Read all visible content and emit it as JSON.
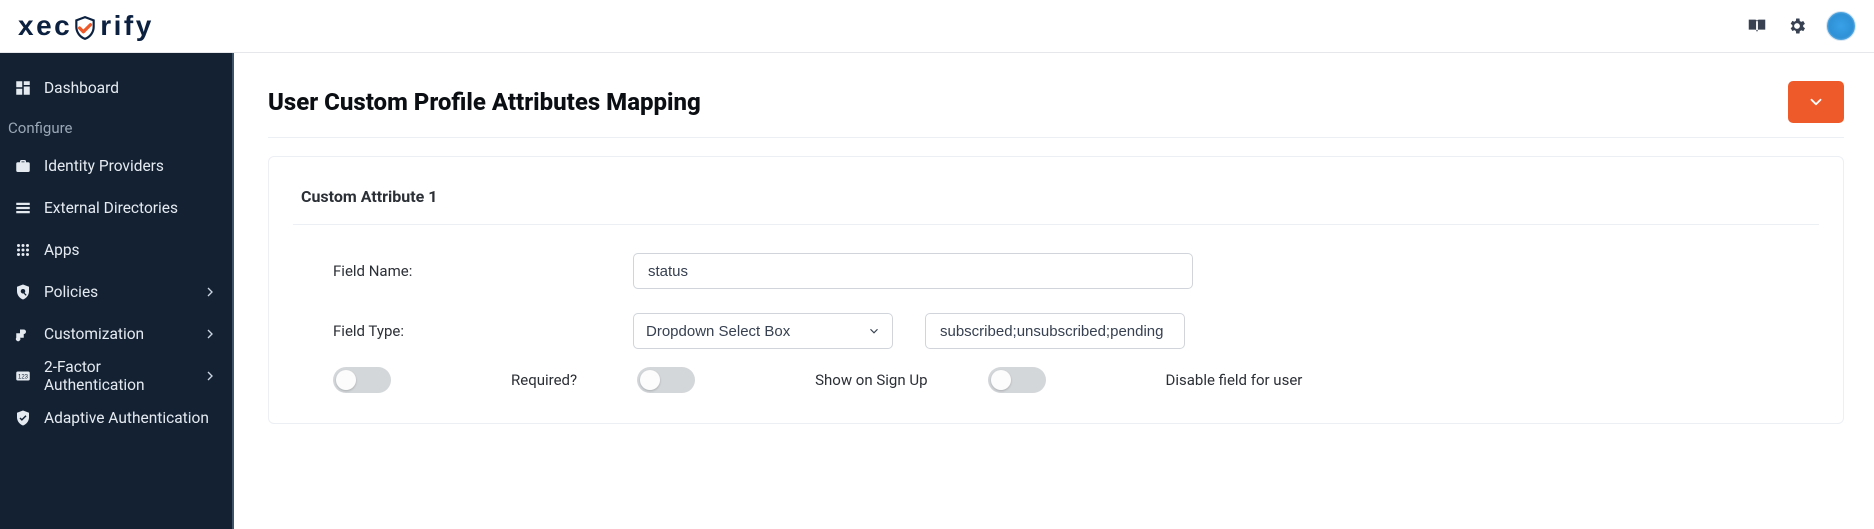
{
  "brand": {
    "name": "xecurify"
  },
  "header": {
    "title": "User Custom Profile Attributes Mapping"
  },
  "sidebar": {
    "section_label": "Configure",
    "items": [
      {
        "label": "Dashboard"
      },
      {
        "label": "Identity Providers"
      },
      {
        "label": "External Directories"
      },
      {
        "label": "Apps"
      },
      {
        "label": "Policies",
        "has_children": true
      },
      {
        "label": "Customization",
        "has_children": true
      },
      {
        "label": "2-Factor Authentication",
        "has_children": true
      },
      {
        "label": "Adaptive Authentication"
      }
    ]
  },
  "card": {
    "title": "Custom Attribute 1",
    "field_name_label": "Field Name:",
    "field_name_value": "status",
    "field_type_label": "Field Type:",
    "field_type_value": "Dropdown Select Box",
    "options_value": "subscribed;unsubscribed;pending",
    "toggles": {
      "required_label": "Required?",
      "show_signup_label": "Show on Sign Up",
      "disable_label": "Disable field for user"
    }
  },
  "colors": {
    "accent": "#ee5a2a",
    "sidebar": "#132133"
  }
}
